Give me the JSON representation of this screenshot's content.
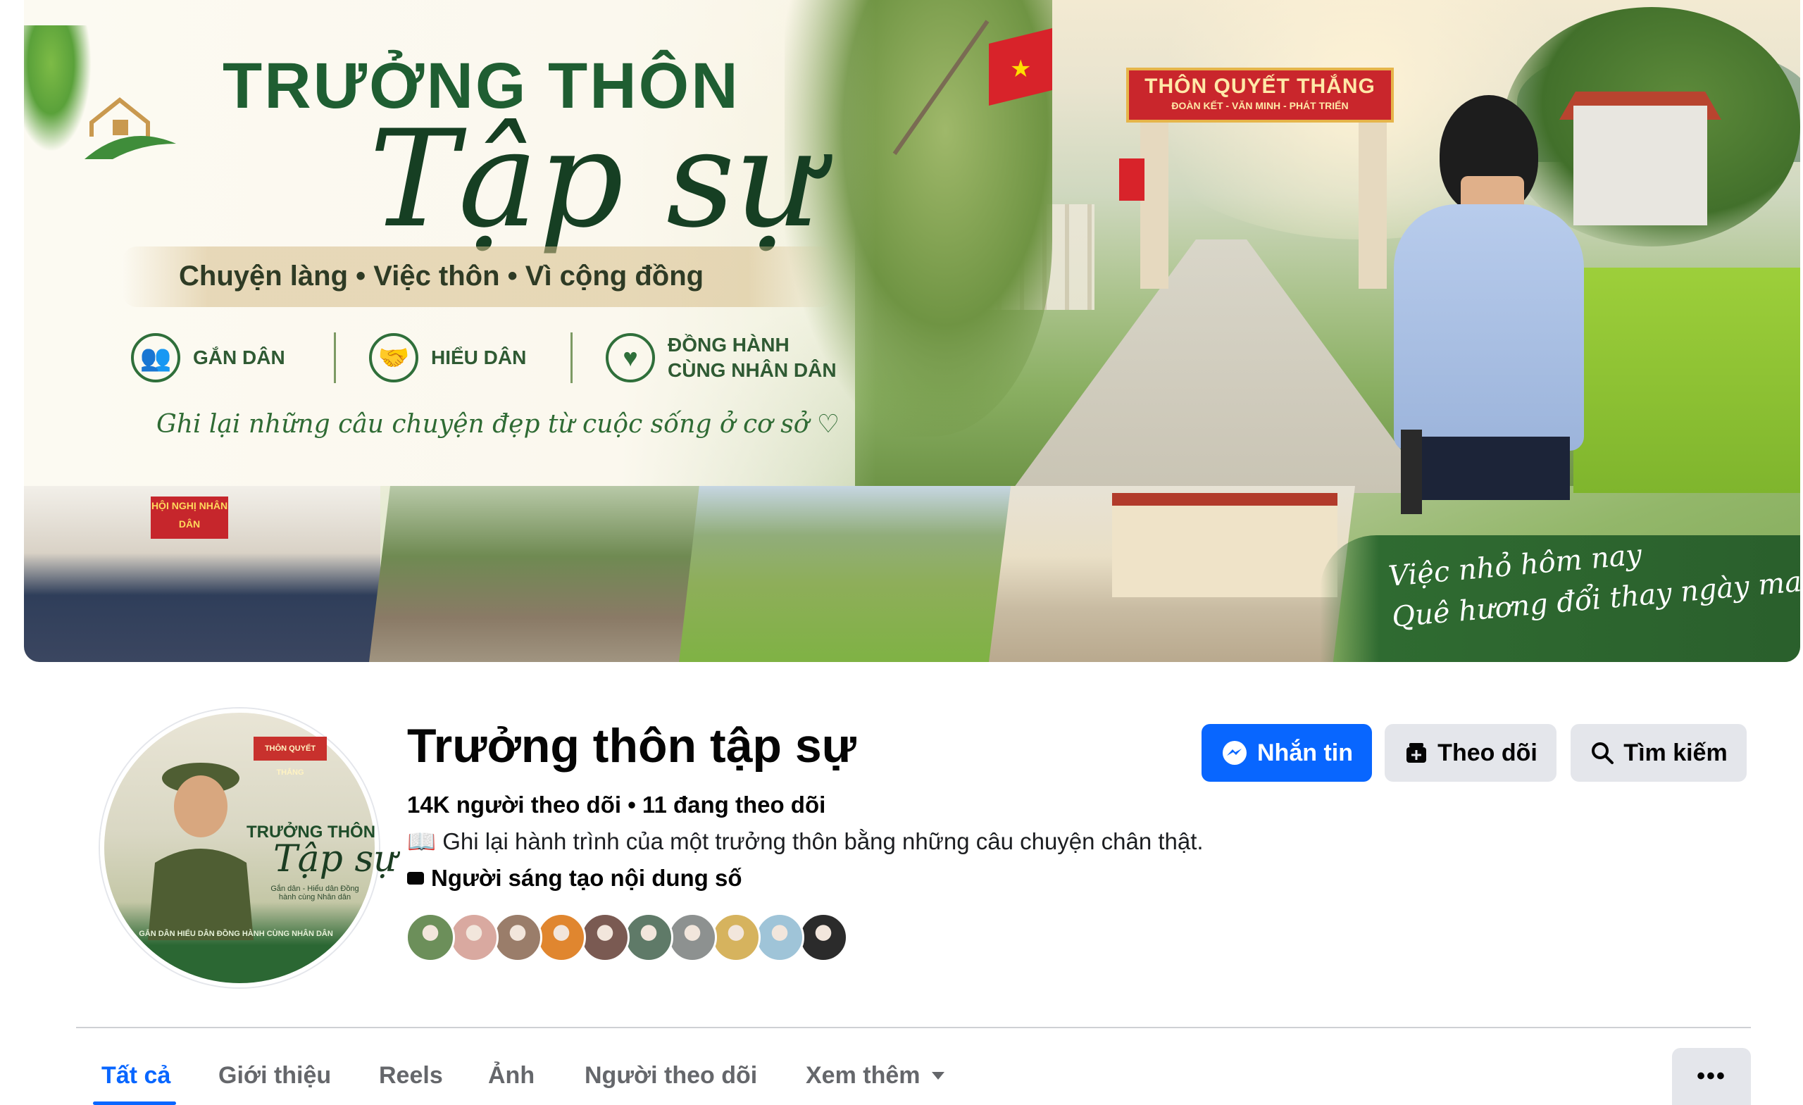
{
  "cover": {
    "title_line1": "TRƯỞNG THÔN",
    "title_line2": "Tập sự",
    "tagline": "Chuyện làng  •  Việc thôn  •  Vì cộng đồng",
    "badges": [
      {
        "label": "GẮN DÂN",
        "icon": "people-icon"
      },
      {
        "label": "HIỂU DÂN",
        "icon": "handshake-icon"
      },
      {
        "label": "ĐỒNG HÀNH\nCÙNG NHÂN DÂN",
        "icon": "heart-hands-icon"
      }
    ],
    "slogan": "Ghi lại những câu chuyện đẹp từ cuộc sống ở cơ sở ♡",
    "gate_sign_title": "THÔN QUYẾT THẮNG",
    "gate_sign_sub": "ĐOÀN KẾT - VĂN MINH - PHÁT TRIỂN",
    "strip_banner": "HỘI NGHỊ NHÂN DÂN",
    "brush_line1": "Việc nhỏ hôm nay",
    "brush_line2": "Quê hương đổi thay ngày mai"
  },
  "avatar": {
    "sign": "THÔN QUYẾT THẮNG",
    "title1": "TRƯỞNG THÔN",
    "title2": "Tập sự",
    "sub": "Gắn dân - Hiểu dân Đồng hành cùng Nhân dân",
    "band": "GẮN DÂN   HIỂU DÂN   ĐỒNG HÀNH CÙNG NHÂN DÂN"
  },
  "profile": {
    "name": "Trưởng thôn tập sự",
    "stats": "14K người theo dõi • 11 đang theo dõi",
    "bio": "📖 Ghi lại hành trình của một trưởng thôn bằng những câu chuyện chân thật.",
    "category": "Người sáng tạo nội dung số",
    "follower_avatar_colors": [
      "#6c8f5a",
      "#d9a9a0",
      "#9a7d6a",
      "#e0862f",
      "#7a5a52",
      "#5f7a68",
      "#8d9190",
      "#d6b35e",
      "#9fc4d8",
      "#2b2b2b"
    ]
  },
  "actions": {
    "message": "Nhắn tin",
    "follow": "Theo dõi",
    "search": "Tìm kiếm"
  },
  "tabs": {
    "all": "Tất cả",
    "about": "Giới thiệu",
    "reels": "Reels",
    "photos": "Ảnh",
    "followers": "Người theo dõi",
    "more": "Xem thêm",
    "dots": "•••"
  },
  "colors": {
    "accent": "#0866ff",
    "secondary_button": "#e4e6eb",
    "cover_green": "#1f5e32"
  }
}
